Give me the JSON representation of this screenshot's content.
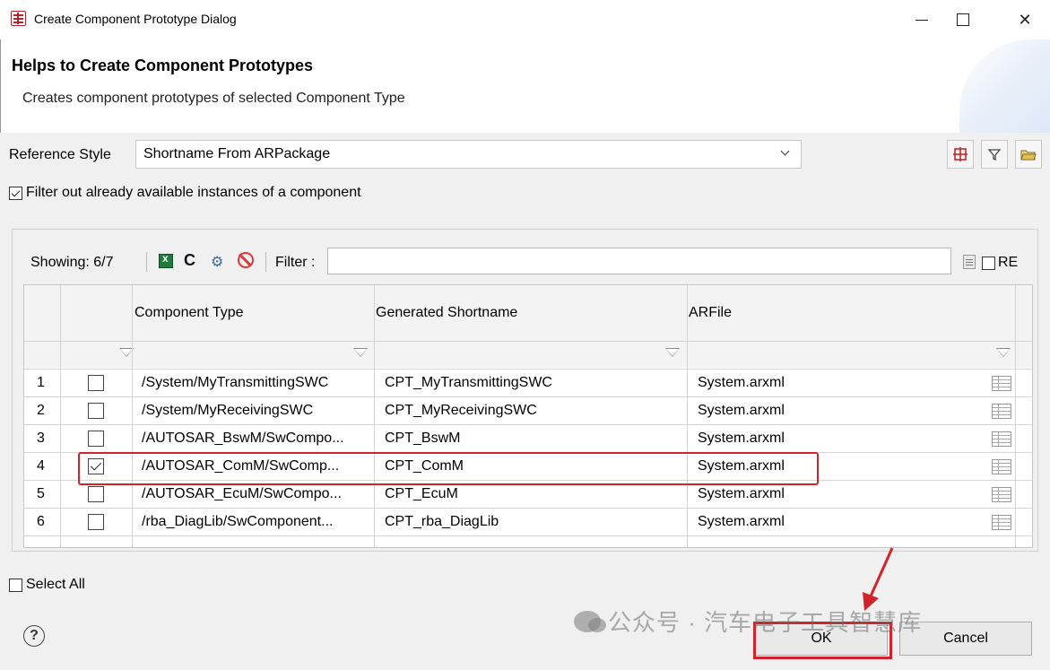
{
  "window": {
    "title": "Create Component Prototype Dialog",
    "close_glyph": "✕"
  },
  "header": {
    "title": "Helps to Create Component Prototypes",
    "subtitle": "Creates component prototypes of selected Component Type"
  },
  "reference_style": {
    "label": "Reference Style",
    "value": "Shortname From ARPackage"
  },
  "filter_instances": {
    "label": "Filter out already available instances of a component",
    "checked": true
  },
  "table_toolbar": {
    "showing": "Showing: 6/7",
    "filter_label": "Filter :",
    "filter_value": "",
    "re_label": "RE",
    "refresh_glyph": "C",
    "gear_glyph": "⚙"
  },
  "table": {
    "columns": [
      "Component Type",
      "Generated Shortname",
      "ARFile"
    ],
    "rows": [
      {
        "num": "1",
        "checked": false,
        "type": "/System/MyTransmittingSWC",
        "shortname": "CPT_MyTransmittingSWC",
        "file": "System.arxml"
      },
      {
        "num": "2",
        "checked": false,
        "type": "/System/MyReceivingSWC",
        "shortname": "CPT_MyReceivingSWC",
        "file": "System.arxml"
      },
      {
        "num": "3",
        "checked": false,
        "type": "/AUTOSAR_BswM/SwCompo...",
        "shortname": "CPT_BswM",
        "file": "System.arxml"
      },
      {
        "num": "4",
        "checked": true,
        "type": "/AUTOSAR_ComM/SwComp...",
        "shortname": "CPT_ComM",
        "file": "System.arxml"
      },
      {
        "num": "5",
        "checked": false,
        "type": "/AUTOSAR_EcuM/SwCompo...",
        "shortname": "CPT_EcuM",
        "file": "System.arxml"
      },
      {
        "num": "6",
        "checked": false,
        "type": "/rba_DiagLib/SwComponent...",
        "shortname": "CPT_rba_DiagLib",
        "file": "System.arxml"
      }
    ]
  },
  "select_all": {
    "label": "Select All",
    "checked": false
  },
  "buttons": {
    "ok": "OK",
    "cancel": "Cancel",
    "help": "?"
  },
  "watermark": "公众号 · 汽车电子工具智慧库",
  "colors": {
    "highlight": "#d1232a",
    "accent": "#b4232a"
  }
}
